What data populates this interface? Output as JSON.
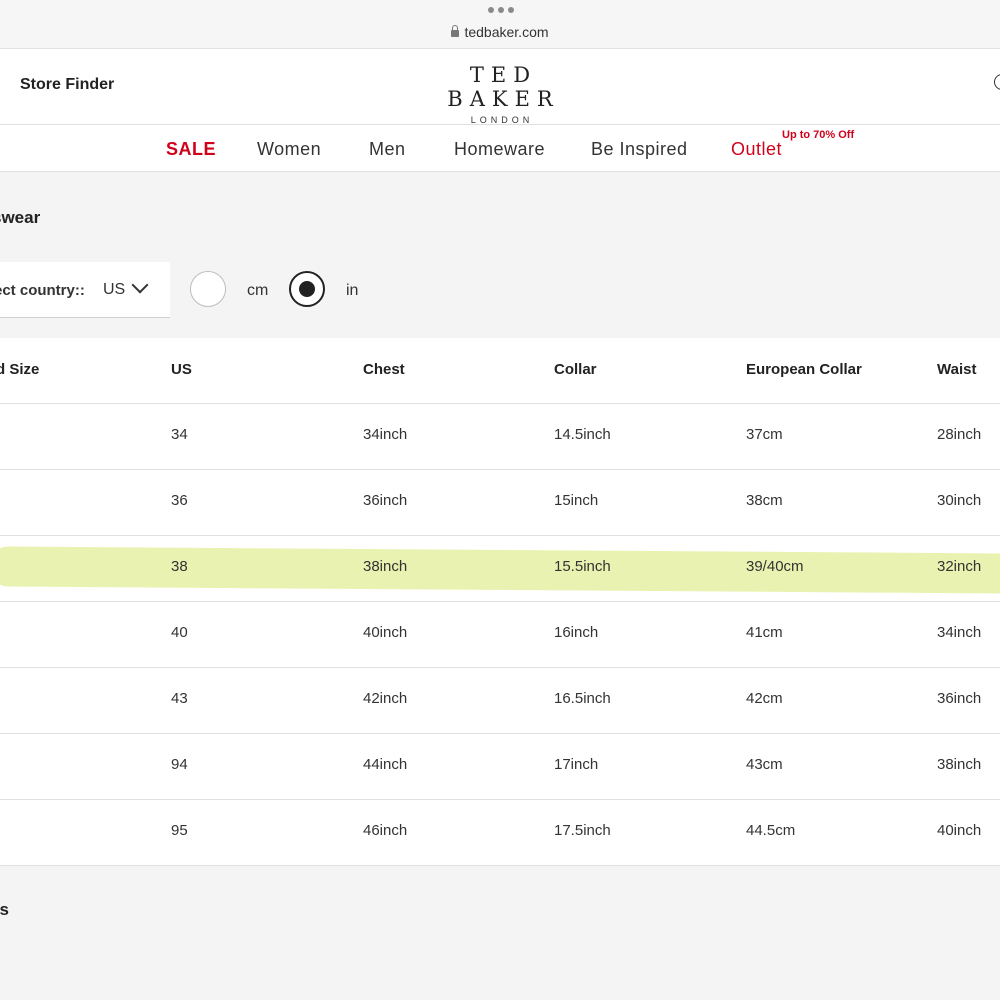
{
  "browser": {
    "url": "tedbaker.com"
  },
  "header": {
    "store_finder": "Store Finder",
    "logo_main": "TED BAKER",
    "logo_sub": "LONDON"
  },
  "nav": {
    "items": [
      {
        "label": "SALE"
      },
      {
        "label": "Women"
      },
      {
        "label": "Men"
      },
      {
        "label": "Homeware"
      },
      {
        "label": "Be Inspired"
      },
      {
        "label": "Outlet"
      }
    ],
    "outlet_badge": "Up to 70% Off"
  },
  "section_title": "swear",
  "controls": {
    "country_label": "ect country::",
    "country_value": "US",
    "unit_options": [
      {
        "label": "cm",
        "selected": false
      },
      {
        "label": "in",
        "selected": true
      }
    ]
  },
  "table": {
    "headers": [
      "d Size",
      "US",
      "Chest",
      "Collar",
      "European Collar",
      "Waist"
    ],
    "rows": [
      [
        "",
        "34",
        "34inch",
        "14.5inch",
        "37cm",
        "28inch"
      ],
      [
        "",
        "36",
        "36inch",
        "15inch",
        "38cm",
        "30inch"
      ],
      [
        "",
        "38",
        "38inch",
        "15.5inch",
        "39/40cm",
        "32inch"
      ],
      [
        "",
        "40",
        "40inch",
        "16inch",
        "41cm",
        "34inch"
      ],
      [
        "",
        "43",
        "42inch",
        "16.5inch",
        "42cm",
        "36inch"
      ],
      [
        "",
        "94",
        "44inch",
        "17inch",
        "43cm",
        "38inch"
      ],
      [
        "",
        "95",
        "46inch",
        "17.5inch",
        "44.5cm",
        "40inch"
      ]
    ],
    "highlight_color": "#e6f0a3"
  },
  "bottom_title": "es"
}
